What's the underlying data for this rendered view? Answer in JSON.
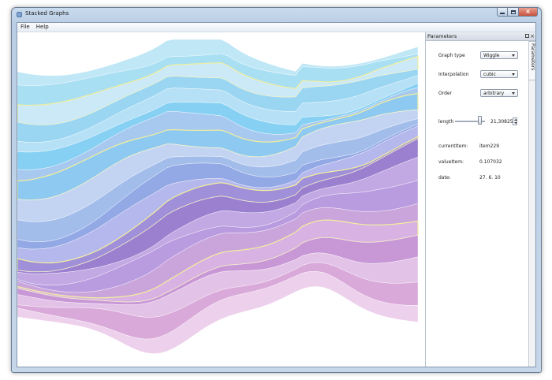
{
  "window": {
    "title": "Stacked Graphs",
    "icon": "app-window-icon"
  },
  "menu": {
    "items": [
      "File",
      "Help"
    ]
  },
  "dock": {
    "title": "Parameters",
    "tab_label": "Parameters",
    "graph_type": {
      "label": "Graph type",
      "value": "Wiggle"
    },
    "interpolation": {
      "label": "Interpolation",
      "value": "cubic"
    },
    "order": {
      "label": "Order",
      "value": "arbitrary"
    },
    "length": {
      "label": "length",
      "value": "21,30825",
      "slider_fraction": 0.8
    },
    "current_item": {
      "label": "currentItem:",
      "value": "item229"
    },
    "value_item": {
      "label": "valueItem:",
      "value": "0.107032"
    },
    "date": {
      "label": "date:",
      "value": "27. 6. 10"
    }
  }
}
